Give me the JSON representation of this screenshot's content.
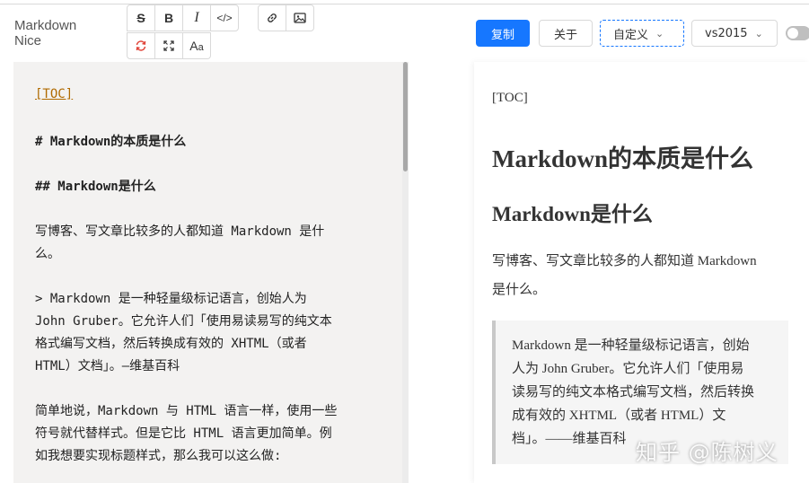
{
  "app": {
    "logo_line1": "Markdown",
    "logo_line2": "Nice"
  },
  "toolbar": {
    "row1": [
      {
        "name": "strikethrough-button",
        "glyph": "S"
      },
      {
        "name": "bold-button",
        "glyph": "B"
      },
      {
        "name": "italic-button",
        "glyph": "I"
      },
      {
        "name": "code-button",
        "glyph": "</>"
      },
      {
        "name": "link-button",
        "glyph": "link-icon"
      },
      {
        "name": "image-button",
        "glyph": "image-icon"
      }
    ],
    "row2": [
      {
        "name": "sync-scroll-button",
        "glyph": "sync-icon"
      },
      {
        "name": "fullscreen-button",
        "glyph": "expand-icon"
      },
      {
        "name": "font-button",
        "glyph": "Aa"
      }
    ],
    "sync_color": "#e0453a"
  },
  "header": {
    "copy_label": "复制",
    "about_label": "关于",
    "custom_select": "自定义",
    "theme_select": "vs2015"
  },
  "editor": {
    "lines": [
      "[TOC]",
      "# Markdown的本质是什么",
      "## Markdown是什么",
      "写博客、写文章比较多的人都知道 Markdown 是什",
      "么。",
      "> Markdown 是一种轻量级标记语言，创始人为",
      "John Gruber。它允许人们「使用易读易写的纯文本",
      "格式编写文档，然后转换成有效的 XHTML（或者",
      "HTML）文档」。—维基百科",
      "简单地说，Markdown 与 HTML 语言一样，使用一些",
      "符号就代替样式。但是它比 HTML 语言更加简单。例",
      "如我想要实现标题样式，那么我可以这么做:"
    ]
  },
  "preview": {
    "toc": "[TOC]",
    "h1": "Markdown的本质是什么",
    "h2": "Markdown是什么",
    "para_line1": "写博客、写文章比较多的人都知道 Markdown",
    "para_line2": "是什么。",
    "quote_lines": [
      "Markdown 是一种轻量级标记语言，创始",
      "人为 John Gruber。它允许人们「使用易",
      "读易写的纯文本格式编写文档，然后转换",
      "成有效的 XHTML（或者 HTML）文",
      "档」。——维基百科"
    ]
  },
  "watermark": "知乎 @陈树义",
  "colors": {
    "primary": "#1677ff",
    "editor_bg": "#f3f2f1",
    "toc_link": "#b06a00"
  }
}
